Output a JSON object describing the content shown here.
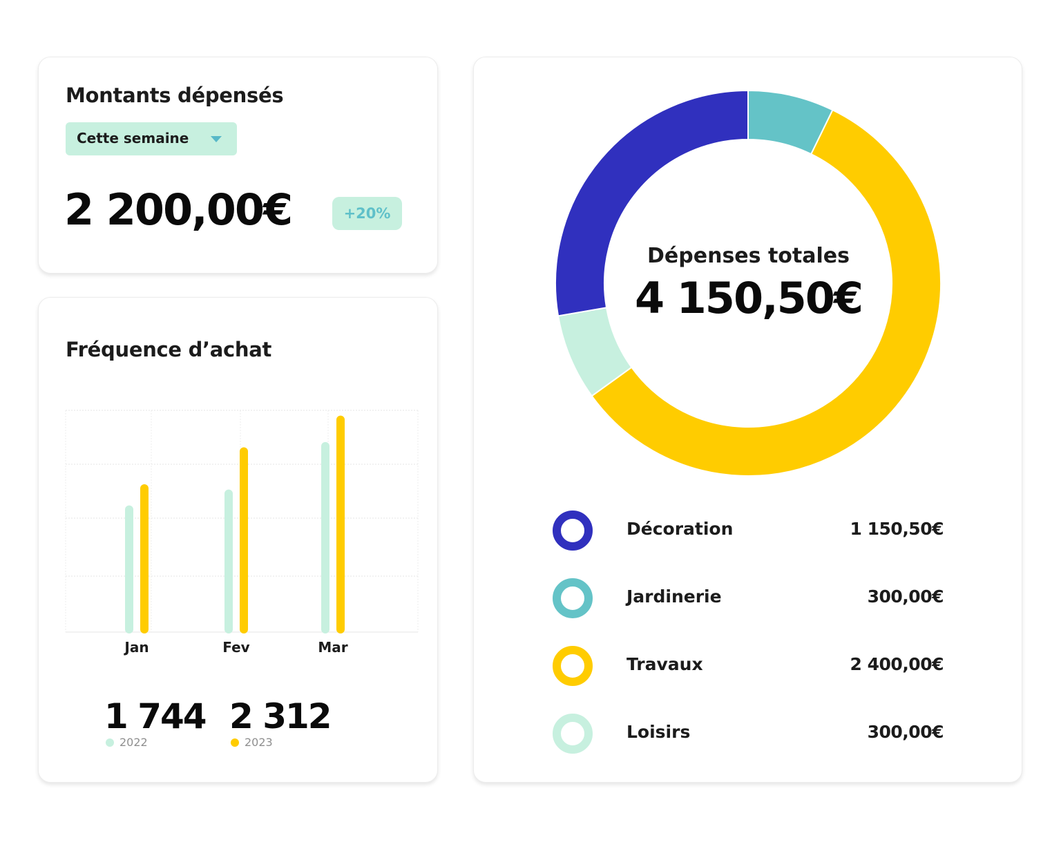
{
  "spent_card": {
    "title": "Montants dépensés",
    "period_select": "Cette semaine",
    "amount": "2 200,00€",
    "change_badge": "+20%"
  },
  "frequency_card": {
    "title": "Fréquence d’achat",
    "stats": [
      {
        "value": "1 744",
        "year": "2022"
      },
      {
        "value": "2 312",
        "year": "2023"
      }
    ]
  },
  "total_card": {
    "label": "Dépenses totales",
    "amount": "4 150,50€",
    "legend": [
      {
        "name": "Décoration",
        "value": "1 150,50€"
      },
      {
        "name": "Jardinerie",
        "value": "300,00€"
      },
      {
        "name": "Travaux",
        "value": "2 400,00€"
      },
      {
        "name": "Loisirs",
        "value": "300,00€"
      }
    ]
  },
  "colors": {
    "decoration": "#3030be",
    "jardinerie": "#64c3c7",
    "travaux": "#ffcc00",
    "loisirs": "#c7f0df",
    "badge_bg": "#c7f0df",
    "badge_text": "#5fc0c9"
  },
  "icons": {
    "dropdown": "chevron-down-icon"
  },
  "chart_data": [
    {
      "type": "bar",
      "title": "",
      "categories": [
        "Jan",
        "Fev",
        "Mar"
      ],
      "series": [
        {
          "name": "2022",
          "values": [
            2.4,
            2.7,
            3.6
          ],
          "color": "#c7f0df"
        },
        {
          "name": "2023",
          "values": [
            2.8,
            3.5,
            4.1
          ],
          "color": "#ffcc00"
        }
      ],
      "ylim": [
        0,
        4.2
      ],
      "grid": true,
      "legend": "bottom"
    },
    {
      "type": "pie",
      "title": "Dépenses totales",
      "labels": [
        "Décoration",
        "Jardinerie",
        "Travaux",
        "Loisirs"
      ],
      "values": [
        1150.5,
        300.0,
        2400.0,
        300.0
      ],
      "colors": [
        "#3030be",
        "#64c3c7",
        "#ffcc00",
        "#c7f0df"
      ],
      "start_label": "Décoration"
    }
  ]
}
